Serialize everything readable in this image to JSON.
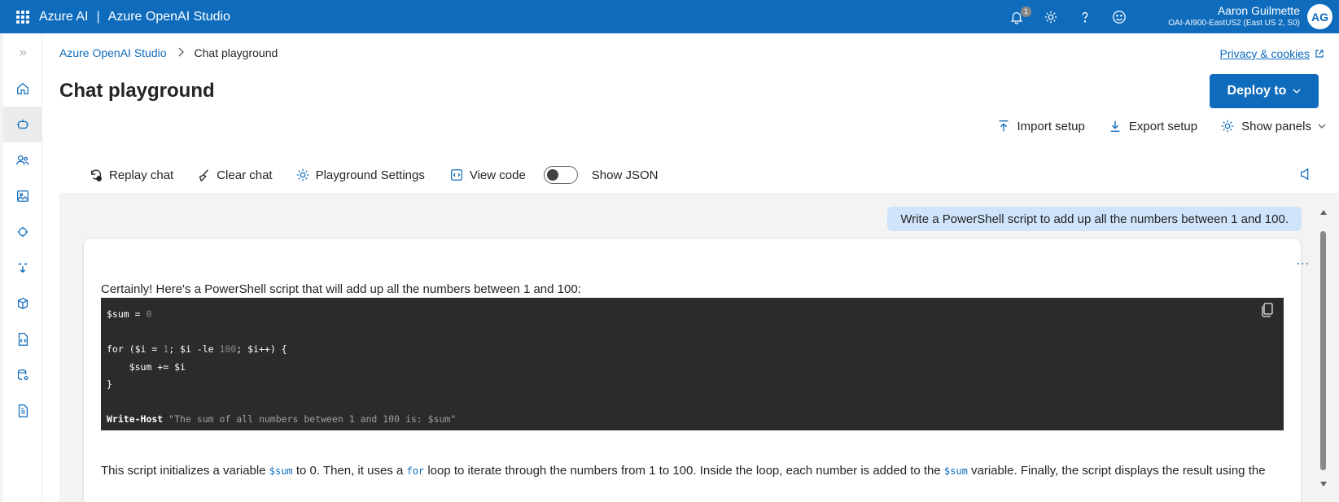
{
  "topbar": {
    "app": "Azure AI",
    "separator": "|",
    "product": "Azure OpenAI Studio",
    "notification_count": "1",
    "user_name": "Aaron Guilmette",
    "user_sub": "OAI-AI900-EastUS2 (East US 2, S0)",
    "avatar_initials": "AG"
  },
  "breadcrumb": {
    "root": "Azure OpenAI Studio",
    "chevron": ">",
    "current": "Chat playground"
  },
  "privacy_link": "Privacy & cookies",
  "page_title": "Chat playground",
  "deploy_button": "Deploy to",
  "setup": {
    "import": "Import setup",
    "export": "Export setup",
    "panels": "Show panels"
  },
  "toolbar": {
    "replay": "Replay chat",
    "clear": "Clear chat",
    "settings": "Playground Settings",
    "view_code": "View code",
    "show_json": "Show JSON"
  },
  "chat": {
    "user_message": "Write a PowerShell script to add up all the numbers between 1 and 100.",
    "more": "...",
    "intro": "Certainly! Here's a PowerShell script that will add up all the numbers between 1 and 100:",
    "code_lines": [
      {
        "a": "$sum = ",
        "num": "0",
        "b": ""
      },
      {
        "a": "",
        "num": "",
        "b": ""
      },
      {
        "a": "for ($i = ",
        "num": "1",
        "b": "; $i -le "
      },
      {
        "a": "    $sum += $i",
        "num": "",
        "b": ""
      },
      {
        "a": "}",
        "num": "",
        "b": ""
      },
      {
        "a": "",
        "num": "",
        "b": ""
      },
      {
        "a": "Write-Host ",
        "num": "",
        "b": ""
      }
    ],
    "code_line3_num2": "100",
    "code_line3_tail": "; $i++) {",
    "code_string": "\"The sum of all numbers between 1 and 100 is: $sum\"",
    "explain_1": "This script initializes a variable ",
    "explain_var": "$sum",
    "explain_2": " to 0. Then, it uses a ",
    "explain_for": "for",
    "explain_3": " loop to iterate through the numbers from 1 to 100. Inside the loop, each number is added to the ",
    "explain_var2": "$sum",
    "explain_4": " variable. Finally, the script displays the result using the"
  },
  "colors": {
    "accent": "#0f6cbd",
    "code_bg": "#2b2b2b",
    "user_bubble": "#cfe4fa"
  }
}
